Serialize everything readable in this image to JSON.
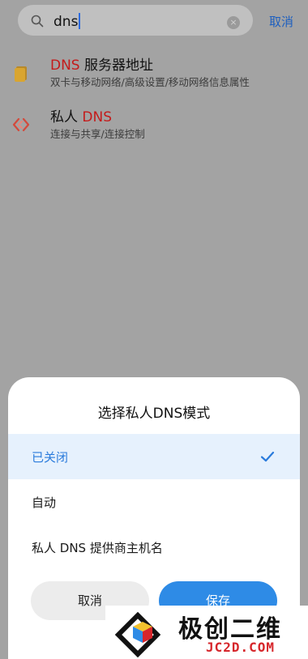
{
  "search": {
    "query": "dns",
    "clear_symbol": "×",
    "cancel_label": "取消"
  },
  "results": [
    {
      "title_highlight": "DNS",
      "title_rest": " 服务器地址",
      "subtitle": "双卡与移动网络/高级设置/移动网络信息属性",
      "icon": "sim-card-icon"
    },
    {
      "title_prefix": "私人 ",
      "title_highlight": "DNS",
      "subtitle": "连接与共享/连接控制",
      "icon": "connection-share-icon"
    }
  ],
  "dialog": {
    "title": "选择私人DNS模式",
    "options": [
      {
        "label": "已关闭",
        "selected": true
      },
      {
        "label": "自动",
        "selected": false
      },
      {
        "label": "私人 DNS 提供商主机名",
        "selected": false
      }
    ],
    "cancel_label": "取消",
    "save_label": "保存"
  },
  "watermark": {
    "name": "极创二维",
    "domain": "JC2D.COM"
  },
  "colors": {
    "accent": "#2e8be6",
    "highlight": "#c41b1b",
    "selected_bg": "#e6f1fd"
  }
}
